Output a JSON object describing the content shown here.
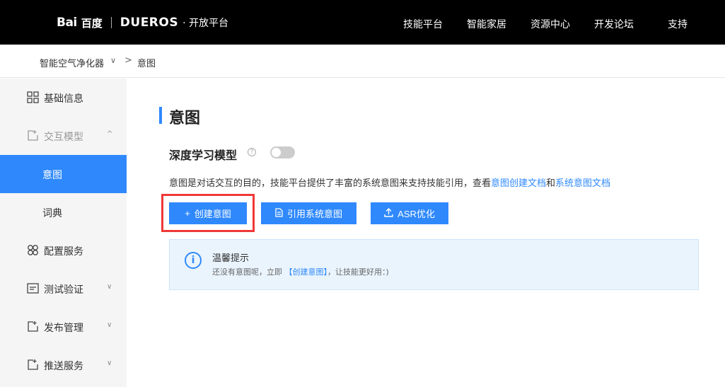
{
  "topbar": {
    "logo_bai": "Bai",
    "logo_baidu_cn": "百度",
    "logo_dueros": "DUER",
    "logo_os": "OS",
    "logo_platform": "· 开放平台",
    "nav": [
      "技能平台",
      "智能家居",
      "资源中心",
      "开发论坛",
      "支持"
    ]
  },
  "breadcrumb": {
    "skill": "智能空气净化器",
    "caret": "∨",
    "arrow": ">",
    "current": "意图"
  },
  "sidebar": {
    "items": [
      {
        "label": "基础信息",
        "icon": "grid-icon"
      },
      {
        "label": "交互模型",
        "icon": "edit-box-icon",
        "chevron": "^"
      },
      {
        "label": "意图"
      },
      {
        "label": "词典"
      },
      {
        "label": "配置服务",
        "icon": "clover-icon"
      },
      {
        "label": "测试验证",
        "icon": "terminal-icon",
        "chevron": "∨"
      },
      {
        "label": "发布管理",
        "icon": "edit-box-icon",
        "chevron": "∨"
      },
      {
        "label": "推送服务",
        "icon": "edit-box-icon",
        "chevron": "∨"
      }
    ]
  },
  "main": {
    "title": "意图",
    "deep_learning_label": "深度学习模型",
    "help_glyph": "?",
    "deep_learning_enabled": false,
    "desc_prefix": "意图是对话交互的目的，技能平台提供了丰富的系统意图来支持技能引用，查看",
    "desc_link1": "意图创建文档",
    "desc_and": "和",
    "desc_link2": "系统意图文档",
    "buttons": {
      "create": "创建意图",
      "create_icon": "+",
      "reference": "引用系统意图",
      "asr": "ASR优化"
    },
    "tip": {
      "icon": "i",
      "title": "温馨提示",
      "text_prefix": "还没有意图呢，立即 ",
      "link": "【创建意图】",
      "text_suffix": "，让技能更好用：)"
    }
  },
  "colors": {
    "accent": "#2f89fc",
    "highlight_border": "#f03838",
    "topbar_bg": "#000000"
  }
}
